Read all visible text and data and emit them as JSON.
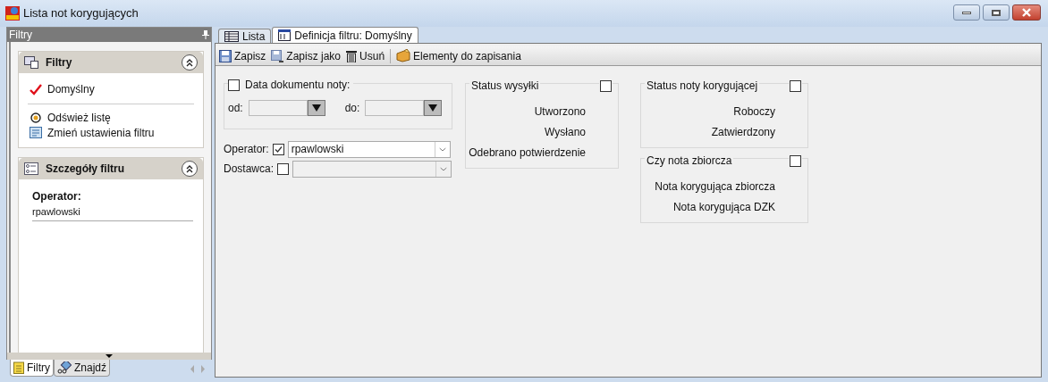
{
  "window": {
    "title": "Lista not korygujących"
  },
  "side_panel": {
    "title": "Filtry",
    "filters_section": {
      "title": "Filtry",
      "expanded": true,
      "filters": [
        {
          "label": "Domyślny",
          "selected": true
        }
      ],
      "actions": [
        {
          "kind": "refresh",
          "label": "Odśwież listę"
        },
        {
          "kind": "settings",
          "label": "Zmień ustawienia filtru"
        }
      ]
    },
    "details_section": {
      "title": "Szczegóły filtru",
      "expanded": true,
      "field_label": "Operator:",
      "field_value": "rpawlowski"
    },
    "bottom_tabs": [
      {
        "kind": "notes",
        "label": "Filtry",
        "selected": true
      },
      {
        "kind": "find",
        "label": "Znajdź",
        "selected": false
      }
    ]
  },
  "tabs": [
    {
      "kind": "list",
      "label": "Lista",
      "selected": false
    },
    {
      "kind": "definition",
      "label": "Definicja filtru: Domyślny",
      "selected": true
    }
  ],
  "toolbar": [
    {
      "kind": "save",
      "label": "Zapisz"
    },
    {
      "kind": "save_as",
      "label": "Zapisz jako"
    },
    {
      "kind": "delete",
      "label": "Usuń"
    },
    {
      "kind": "items",
      "label": "Elementy do zapisania"
    }
  ],
  "date_group": {
    "label": "Data dokumentu noty:",
    "checked": false,
    "from_label": "od:",
    "to_label": "do:"
  },
  "operator": {
    "label": "Operator:",
    "checked": true,
    "value": "rpawlowski"
  },
  "supplier": {
    "label": "Dostawca:",
    "checked": false
  },
  "groups": [
    {
      "title": "Status wysyłki",
      "checked": false,
      "options": [
        "Utworzono",
        "Wysłano",
        "Odebrano potwierdzenie"
      ]
    },
    {
      "title": "Status noty korygującej",
      "checked": false,
      "options": [
        "Roboczy",
        "Zatwierdzony"
      ]
    },
    {
      "title": "Czy nota zbiorcza",
      "checked": false,
      "options": [
        "Nota korygująca zbiorcza",
        "Nota korygująca DZK"
      ]
    }
  ]
}
